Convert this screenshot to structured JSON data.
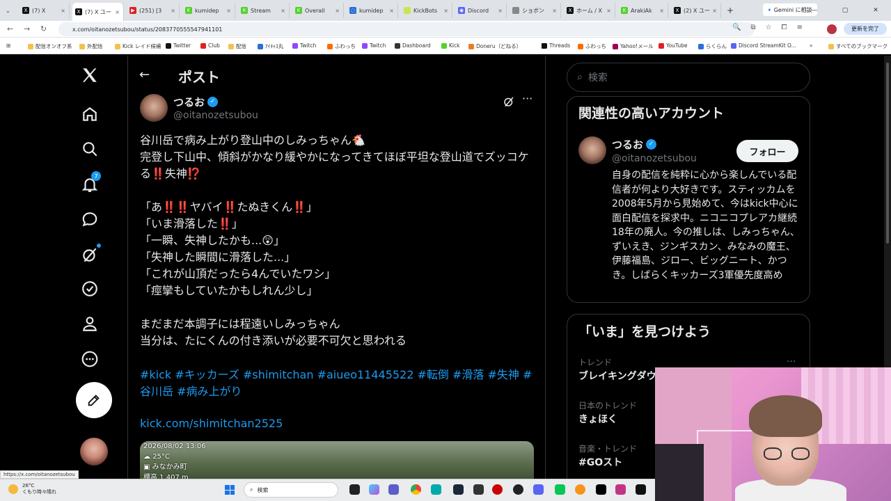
{
  "browser": {
    "tabs": [
      {
        "label": "(7) X",
        "color": "#111"
      },
      {
        "label": "(7) X ユー",
        "color": "#111"
      },
      {
        "label": "(251) [3",
        "color": "#e02020"
      },
      {
        "label": "kumidep",
        "color": "#53d12c"
      },
      {
        "label": "Stream",
        "color": "#53d12c"
      },
      {
        "label": "Overall",
        "color": "#53d12c"
      },
      {
        "label": "kumidep",
        "color": "#2a6fd6"
      },
      {
        "label": "KickBots",
        "color": "#c6e84a"
      },
      {
        "label": "Discord",
        "color": "#5865f2"
      },
      {
        "label": "ショボン",
        "color": "#888"
      },
      {
        "label": "ホーム / X",
        "color": "#111"
      },
      {
        "label": "ArakiAk",
        "color": "#53d12c"
      },
      {
        "label": "(2) X ユー",
        "color": "#111"
      }
    ],
    "gemini_label": "Gemini に相談",
    "url": "x.com/oitanozetsubou/status/2083770555547941101",
    "update_label": "更新を完了",
    "bookmarks": [
      "配信オンオフ系",
      "外配信",
      "Kick レイド候補",
      "Twitter",
      "Club",
      "配信",
      "ｱｲｷｬｽ丸",
      "Twitch",
      "ふわっち",
      "Twitch",
      "Dashboard",
      "Kick",
      "Doneru（どねる）",
      "|",
      "Threads",
      "ふわっち",
      "Yahoo!メール",
      "YouTube",
      "らくらん",
      "Discord StreamKit O...",
      "すべてのブックマーク"
    ],
    "status_url": "https://x.com/oitanozetsubou"
  },
  "nav": {
    "badge_count": "7"
  },
  "post": {
    "header": "ポスト",
    "author": {
      "name": "つるお",
      "handle": "@oitanozetsubou"
    },
    "text": "谷川岳で病み上がり登山中のしみっちゃん🐔\n完登し下山中、傾斜がかなり緩やかになってきてほぼ平坦な登山道でズッコケる‼️失神⁉️\n\n「あ‼️‼️ヤバイ‼️たぬきくん‼️」\n「いま滑落した‼️」\n「一瞬、失神したかも...😲」\n「失神した瞬間に滑落した...」\n「これが山頂だったら4んでいたワシ」\n「痙攣もしていたかもしれん少し」\n\nまだまだ本調子には程遠いしみっちゃん\n当分は、たにくんの付き添いが必要不可欠と思われる",
    "hashtags": "#kick #キッカーズ #shimitchan #aiueo11445522 #転倒 #滑落 #失神 #谷川岳 #病み上がり",
    "link": "kick.com/shimitchan2525",
    "media_overlay": {
      "datetime": "2026/08/02 13:06",
      "temp": "25°C",
      "place": "みなかみ町",
      "altitude": "標高 1,407 m"
    }
  },
  "sidebar": {
    "search_placeholder": "検索",
    "related_title": "関連性の高いアカウント",
    "related": {
      "name": "つるお",
      "handle": "@oitanozetsubou",
      "follow_label": "フォロー",
      "bio": "自身の配信を純粋に心から楽しんでいる配信者が何より大好きです。スティッカムを2008年5月から見始めて、今はkick中心に面白配信を探求中。ニコニコプレアカ継続18年の廃人。今の推しは、しみっちゃん、ずいえき、ジンギスカン、みなみの魔王、伊藤福島、ジロー、ビッグニート、かつき。しばらくキッカーズ3軍優先度高め"
    },
    "now_title": "「いま」を見つけよう",
    "trends": [
      {
        "context": "トレンド",
        "name": "ブレイキングダウ"
      },
      {
        "context": "日本のトレンド",
        "name": "きょほく"
      },
      {
        "context": "音楽・トレンド",
        "name": "#GOスト"
      }
    ]
  },
  "taskbar": {
    "weather_temp": "26°C",
    "weather_desc": "くもり時々晴れ",
    "search_label": "検索"
  }
}
